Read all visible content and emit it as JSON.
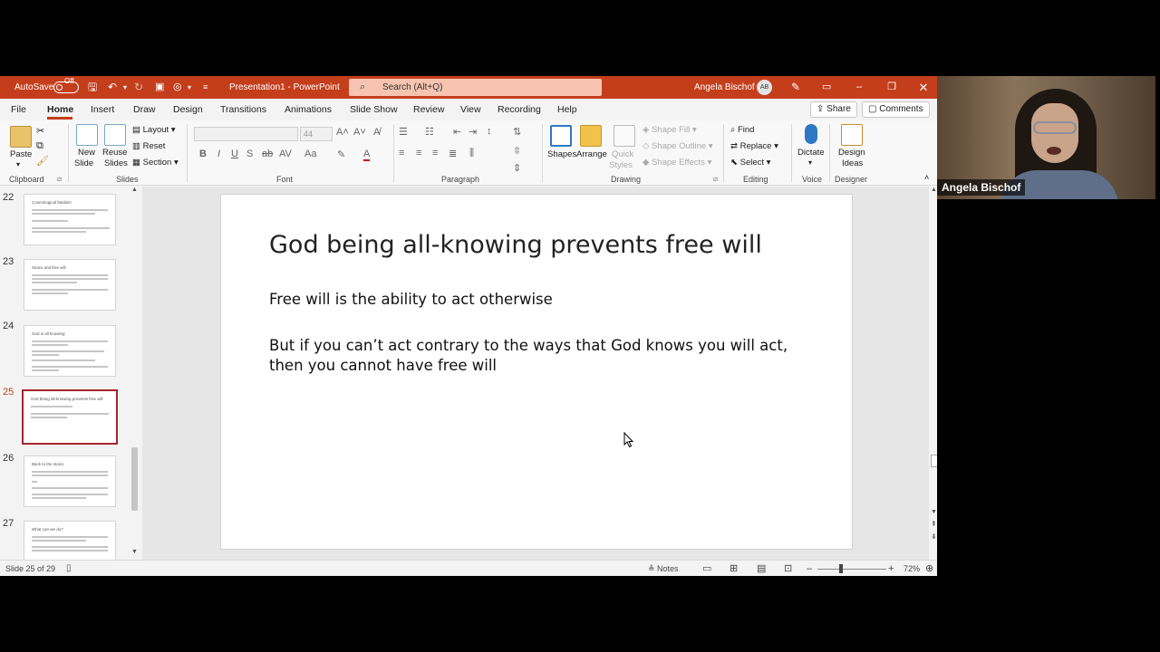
{
  "titlebar": {
    "autosave_label": "AutoSave",
    "autosave_state": "Off",
    "doc_title": "Presentation1 - PowerPoint",
    "search_placeholder": "Search (Alt+Q)",
    "user_name": "Angela Bischof",
    "user_initials": "AB"
  },
  "tabs": [
    "File",
    "Home",
    "Insert",
    "Draw",
    "Design",
    "Transitions",
    "Animations",
    "Slide Show",
    "Review",
    "View",
    "Recording",
    "Help"
  ],
  "active_tab": "Home",
  "tab_buttons": {
    "share": "Share",
    "comments": "Comments"
  },
  "ribbon": {
    "clipboard": {
      "paste": "Paste",
      "label": "Clipboard"
    },
    "slides": {
      "new_slide_1": "New",
      "new_slide_2": "Slide",
      "reuse_1": "Reuse",
      "reuse_2": "Slides",
      "layout": "Layout",
      "reset": "Reset",
      "section": "Section",
      "label": "Slides"
    },
    "font": {
      "size": "44",
      "label": "Font"
    },
    "paragraph": {
      "label": "Paragraph"
    },
    "drawing": {
      "shapes": "Shapes",
      "arrange": "Arrange",
      "quick_1": "Quick",
      "quick_2": "Styles",
      "shape_fill": "Shape Fill",
      "shape_outline": "Shape Outline",
      "shape_effects": "Shape Effects",
      "label": "Drawing"
    },
    "editing": {
      "find": "Find",
      "replace": "Replace",
      "select": "Select",
      "label": "Editing"
    },
    "voice": {
      "dictate": "Dictate",
      "label": "Voice"
    },
    "designer": {
      "ideas_1": "Design",
      "ideas_2": "Ideas",
      "label": "Designer"
    }
  },
  "thumbnails": [
    {
      "num": "22",
      "title": "Cosmological fatalism"
    },
    {
      "num": "23",
      "title": "Stoics and free will"
    },
    {
      "num": "24",
      "title": "God is all knowing"
    },
    {
      "num": "25",
      "title": "God being all-knowing prevents free will"
    },
    {
      "num": "26",
      "title": "Back to the stoics"
    },
    {
      "num": "27",
      "title": "What can we do?"
    }
  ],
  "selected_slide": "25",
  "slide": {
    "title": "God being all-knowing prevents free will",
    "para1": "Free will is the ability to act otherwise",
    "para2_line1": "But if you can’t act contrary to the ways that God knows you will act,",
    "para2_line2": "then you cannot have free will"
  },
  "status": {
    "slide_counter": "Slide 25 of 29",
    "notes": "Notes",
    "zoom": "72%"
  },
  "webcam": {
    "name": "Angela Bischof"
  }
}
